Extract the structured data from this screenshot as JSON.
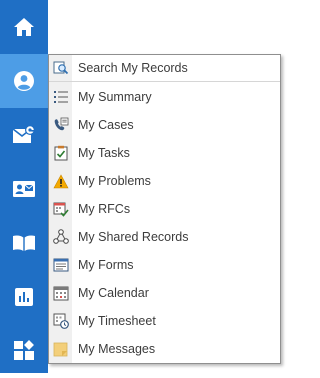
{
  "nav": {
    "items": [
      {
        "name": "home",
        "icon": "home-icon"
      },
      {
        "name": "my-records",
        "icon": "user-circle-icon",
        "active": true
      },
      {
        "name": "messages",
        "icon": "mail-badge-icon"
      },
      {
        "name": "contacts",
        "icon": "contact-card-icon"
      },
      {
        "name": "knowledge",
        "icon": "open-book-icon"
      },
      {
        "name": "reports",
        "icon": "bar-chart-icon"
      },
      {
        "name": "apps",
        "icon": "widgets-icon"
      }
    ],
    "colors": {
      "rail": "#1f6fc5",
      "active": "#4d9de6"
    }
  },
  "menu": {
    "search_label": "Search My Records",
    "items": [
      {
        "label": "My Summary",
        "icon": "list-icon"
      },
      {
        "label": "My Cases",
        "icon": "phone-document-icon"
      },
      {
        "label": "My Tasks",
        "icon": "clipboard-check-icon"
      },
      {
        "label": "My Problems",
        "icon": "warning-icon"
      },
      {
        "label": "My RFCs",
        "icon": "calendar-check-icon"
      },
      {
        "label": "My Shared Records",
        "icon": "share-network-icon"
      },
      {
        "label": "My Forms",
        "icon": "form-icon"
      },
      {
        "label": "My Calendar",
        "icon": "calendar-grid-icon"
      },
      {
        "label": "My Timesheet",
        "icon": "timesheet-icon"
      },
      {
        "label": "My Messages",
        "icon": "message-note-icon"
      }
    ]
  }
}
